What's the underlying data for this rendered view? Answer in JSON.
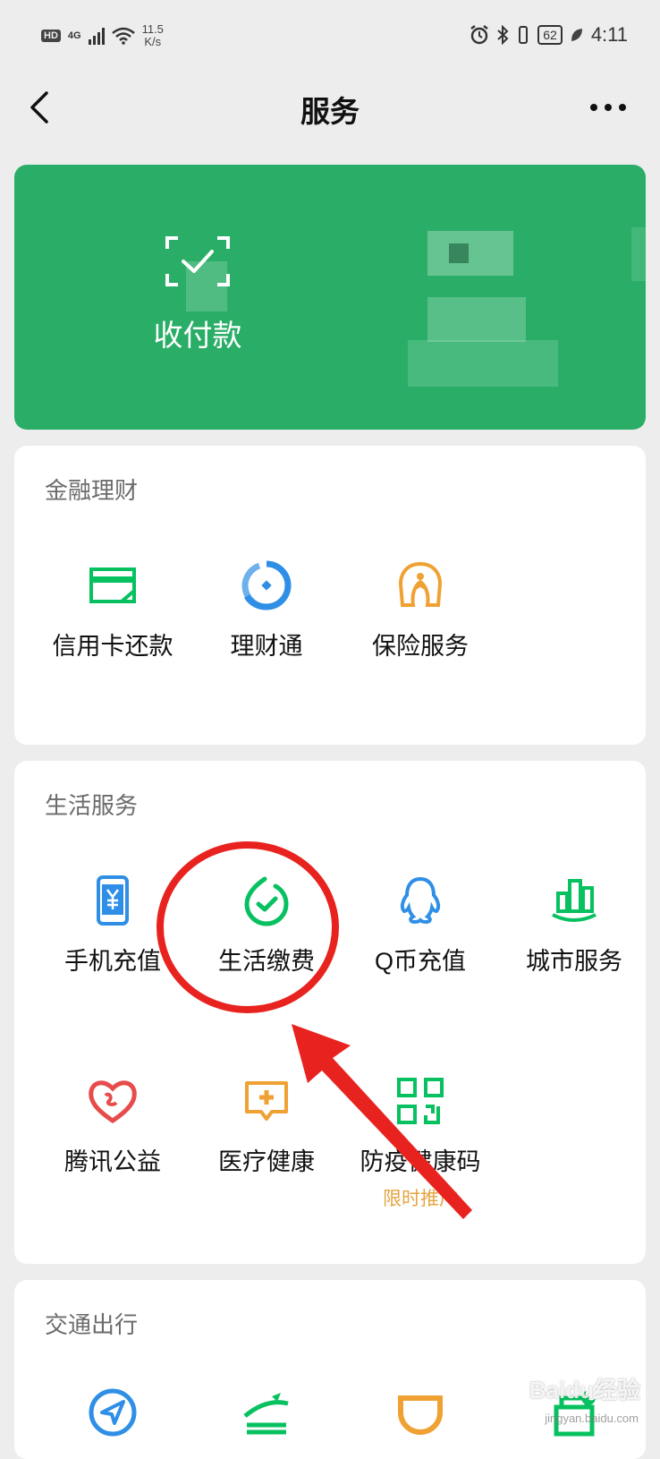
{
  "status_bar": {
    "hd": "HD",
    "network": "4G",
    "speed_value": "11.5",
    "speed_unit": "K/s",
    "battery": "62",
    "time": "4:11"
  },
  "nav": {
    "title": "服务",
    "back_icon": "chevron-left-icon",
    "more_icon": "more-dots-icon"
  },
  "pay": {
    "label": "收付款",
    "icon": "scan-check-icon",
    "color": "#2aae67"
  },
  "finance": {
    "title": "金融理财",
    "items": [
      {
        "label": "信用卡还款",
        "icon": "credit-card-icon",
        "color": "#07c160"
      },
      {
        "label": "理财通",
        "icon": "licaitong-icon",
        "color": "#2f8fe6"
      },
      {
        "label": "保险服务",
        "icon": "insurance-icon",
        "color": "#f0a133"
      }
    ]
  },
  "life": {
    "title": "生活服务",
    "items": [
      {
        "label": "手机充值",
        "icon": "phone-topup-icon",
        "color": "#2f8fe6"
      },
      {
        "label": "生活缴费",
        "icon": "utility-bill-icon",
        "color": "#07c160"
      },
      {
        "label": "Q币充值",
        "icon": "qq-icon",
        "color": "#2f8fe6"
      },
      {
        "label": "城市服务",
        "icon": "city-service-icon",
        "color": "#07c160"
      },
      {
        "label": "腾讯公益",
        "icon": "charity-heart-icon",
        "color": "#e74c4c"
      },
      {
        "label": "医疗健康",
        "icon": "medical-icon",
        "color": "#f0a133"
      },
      {
        "label": "防疫健康码",
        "icon": "qr-code-icon",
        "color": "#07c160",
        "badge": "限时推广"
      }
    ]
  },
  "transport": {
    "title": "交通出行",
    "items": [
      {
        "icon": "navigation-icon",
        "color": "#2f8fe6"
      },
      {
        "icon": "train-ticket-icon",
        "color": "#07c160"
      },
      {
        "icon": "didi-icon",
        "color": "#f0a133"
      },
      {
        "icon": "hotel-icon",
        "color": "#07c160"
      }
    ]
  },
  "annotation": {
    "highlight_color": "#e8231f"
  },
  "watermark": {
    "text": "Baidu经验",
    "sub": "jingyan.baidu.com"
  }
}
